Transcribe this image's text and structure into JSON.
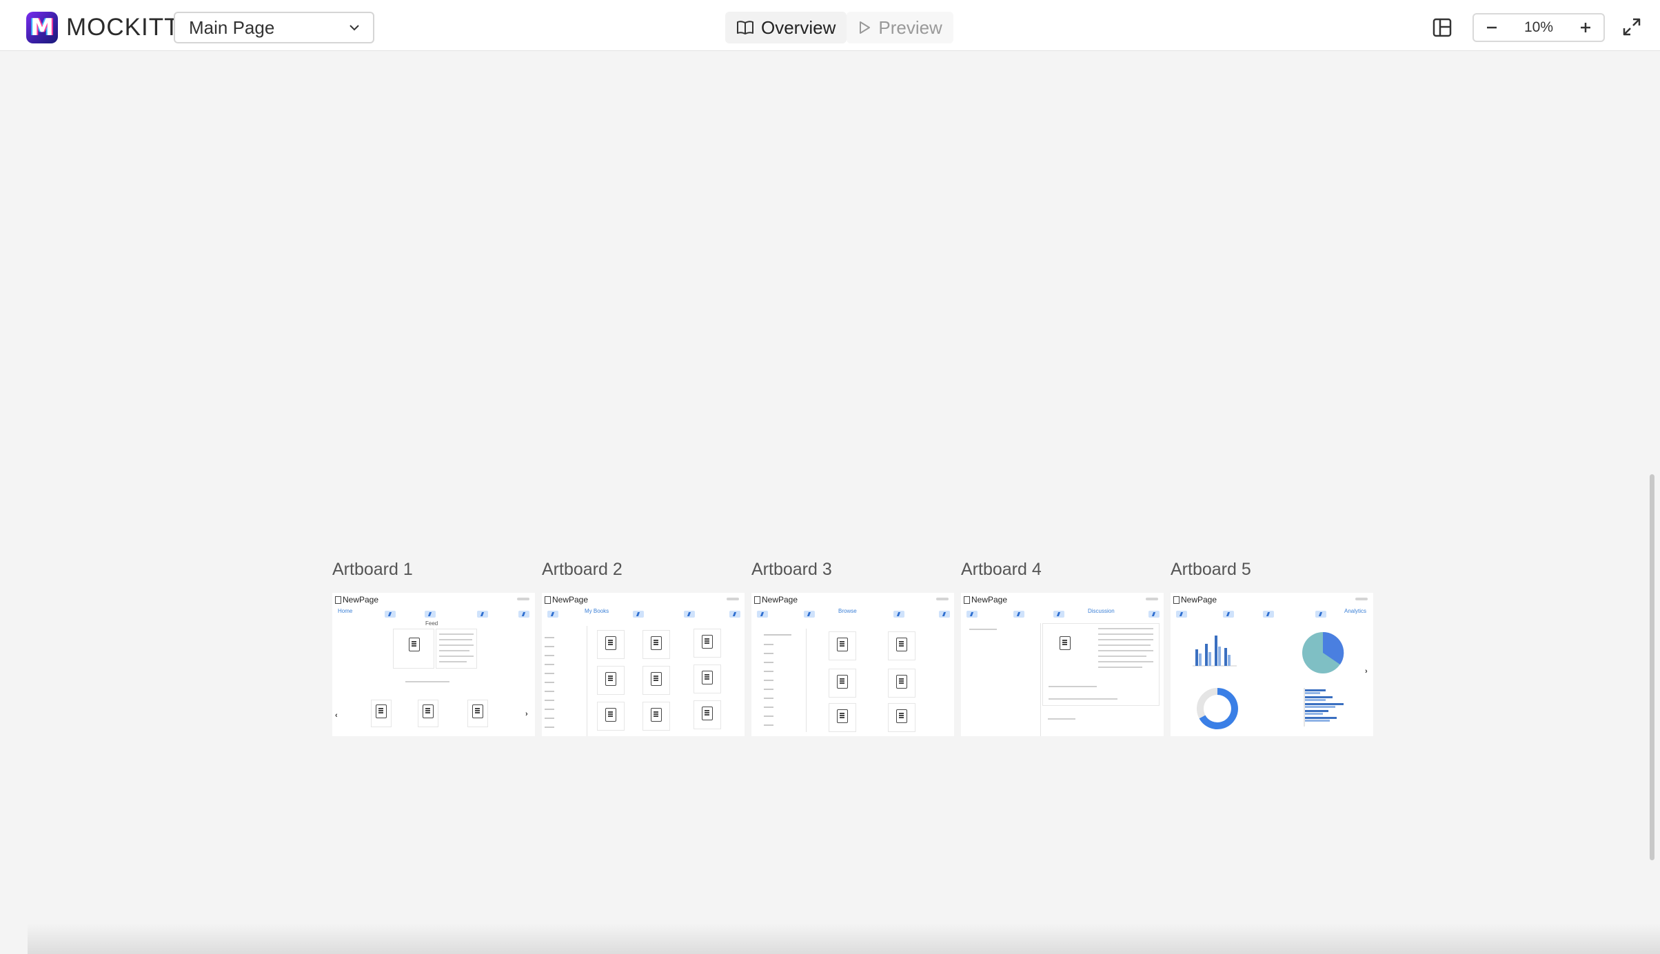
{
  "app": {
    "brand_name": "MOCKITT",
    "brand_glyph": "M",
    "logo_gradient": [
      "#7a2cf0",
      "#1a1a7a"
    ]
  },
  "header": {
    "page_select": {
      "value": "Main Page"
    },
    "modes": [
      {
        "label": "Overview",
        "icon": "book-icon",
        "active": true
      },
      {
        "label": "Preview",
        "icon": "play-icon",
        "active": false
      }
    ],
    "zoom": {
      "value": "10%"
    }
  },
  "artboards": [
    {
      "title": "Artboard 1",
      "mock": {
        "heading": "NewPage",
        "active_tab": "Home",
        "section": "Feed"
      }
    },
    {
      "title": "Artboard 2",
      "mock": {
        "heading": "NewPage",
        "active_tab": "My Books"
      }
    },
    {
      "title": "Artboard 3",
      "mock": {
        "heading": "NewPage",
        "active_tab": "Browse"
      }
    },
    {
      "title": "Artboard 4",
      "mock": {
        "heading": "NewPage",
        "active_tab": "Discussion"
      }
    },
    {
      "title": "Artboard 5",
      "mock": {
        "heading": "NewPage",
        "active_tab": "Analytics"
      }
    }
  ],
  "colors": {
    "accent": "#3a7fd6",
    "canvas_bg": "#f4f4f4"
  }
}
